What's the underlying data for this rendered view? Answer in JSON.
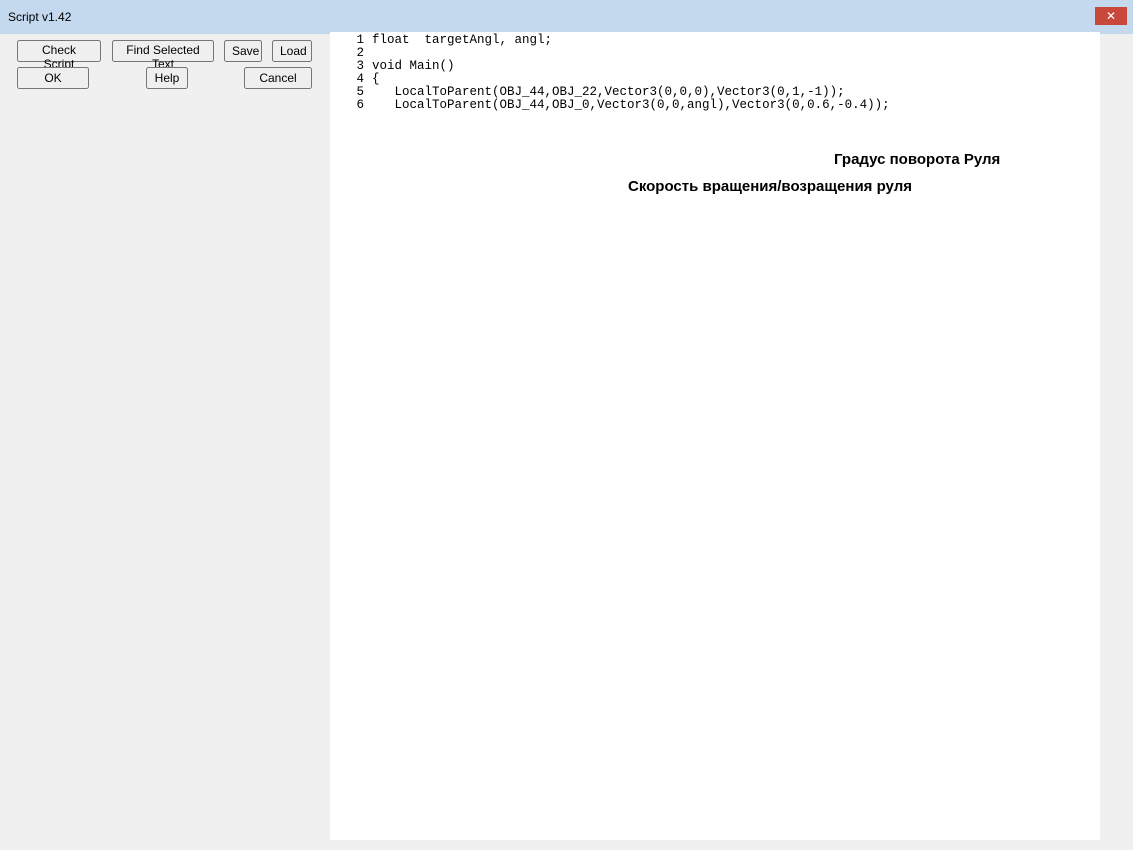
{
  "title": "Script v1.42",
  "close": "✕",
  "buttons": [
    "Check Script",
    "Find Selected Text",
    "Save",
    "Load",
    "OK",
    "Help",
    "Cancel"
  ],
  "code": [
    "float  targetAngl, angl;",
    "",
    "void Main()",
    "{",
    "   LocalToParent(OBJ_44,OBJ_22,Vector3(0,0,0),Vector3(0,1,-1));",
    "   LocalToParent(OBJ_44,OBJ_0,Vector3(0,0,angl),Vector3(0,0.6,-0.4));"
  ],
  "notes": [
    "Градус поворота Руля",
    "Скорость вращения/возращения руля"
  ]
}
